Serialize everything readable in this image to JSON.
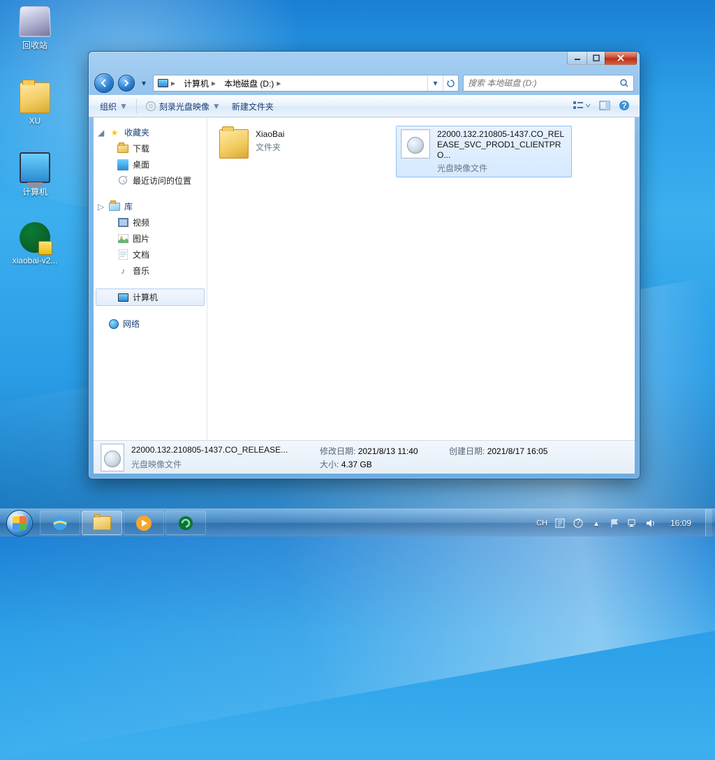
{
  "desktop": {
    "icons": [
      {
        "name": "recycle-bin",
        "label": "回收站"
      },
      {
        "name": "folder-xu",
        "label": "XU"
      },
      {
        "name": "computer",
        "label": "计算机"
      },
      {
        "name": "app-xiaobai",
        "label": "xiaobai-v2..."
      }
    ]
  },
  "window": {
    "breadcrumbs": {
      "root": "计算机",
      "drive": "本地磁盘 (D:)"
    },
    "search_placeholder": "搜索 本地磁盘 (D:)",
    "toolbar": {
      "organize": "组织",
      "burn": "刻录光盘映像",
      "newfolder": "新建文件夹"
    },
    "nav": {
      "favorites": {
        "header": "收藏夹",
        "items": [
          "下载",
          "桌面",
          "最近访问的位置"
        ]
      },
      "libraries": {
        "header": "库",
        "items": [
          "视频",
          "图片",
          "文档",
          "音乐"
        ]
      },
      "computer": "计算机",
      "network": "网络"
    },
    "items": {
      "folder1": {
        "name": "XiaoBai",
        "type": "文件夹"
      },
      "file1": {
        "name": "22000.132.210805-1437.CO_RELEASE_SVC_PROD1_CLIENTPRO...",
        "type": "光盘映像文件"
      }
    },
    "details": {
      "name": "22000.132.210805-1437.CO_RELEASE...",
      "type": "光盘映像文件",
      "modified_label": "修改日期:",
      "modified": "2021/8/13 11:40",
      "size_label": "大小:",
      "size": "4.37 GB",
      "created_label": "创建日期:",
      "created": "2021/8/17 16:05"
    }
  },
  "taskbar": {
    "ime": "CH",
    "clock": "16:09"
  }
}
